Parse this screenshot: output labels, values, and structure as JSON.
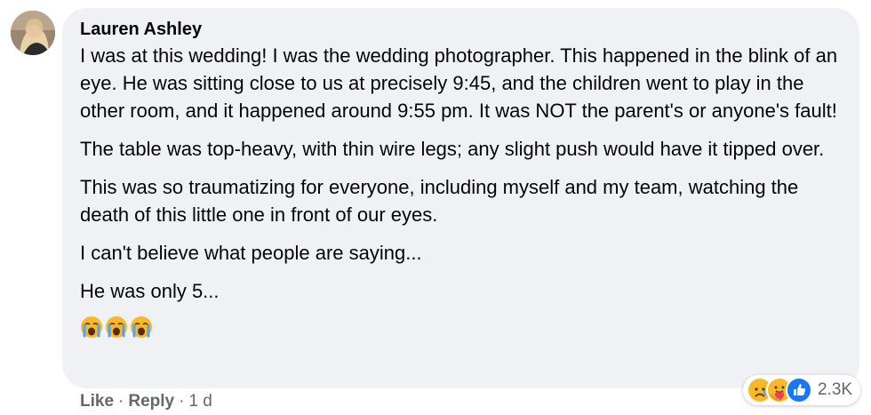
{
  "comment": {
    "author": "Lauren Ashley",
    "paragraphs": [
      "I was at this wedding! I was the wedding photographer. This happened in the blink of an eye. He was sitting close to us at precisely 9:45, and the children went to play in the other room, and it happened around 9:55 pm. It was NOT the parent's or anyone's fault!",
      "The table was top-heavy, with thin wire legs; any slight push would have it tipped over.",
      "This was so traumatizing for everyone, including myself and my team, watching the death of this little one in front of our eyes.",
      "I can't believe what people are saying...",
      "He was only 5..."
    ],
    "emojis": [
      "crying-face",
      "crying-face",
      "crying-face"
    ]
  },
  "actions": {
    "like_label": "Like",
    "reply_label": "Reply",
    "separator": "·",
    "timestamp": "1 d"
  },
  "reactions": {
    "icons": [
      "sad-reaction-icon",
      "care-reaction-icon",
      "like-reaction-icon"
    ],
    "count": "2.3K"
  },
  "colors": {
    "bubble_bg": "#eff1f4",
    "secondary_text": "#65676b",
    "like_blue": "#1877f2",
    "reaction_yellow": "#f7b928"
  }
}
